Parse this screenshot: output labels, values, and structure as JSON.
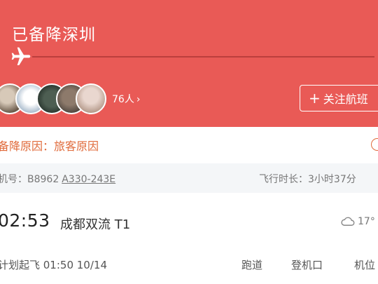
{
  "header": {
    "status": "已备降深圳",
    "follower_count": "76人",
    "follow_button_label": "关注航班",
    "follow_button_plus": "+",
    "chevron": "›"
  },
  "reason": {
    "text": "备降原因：旅客原因"
  },
  "meta": {
    "aircraft_label": "机号：B8962",
    "aircraft_model": "A330-243E",
    "duration": "飞行时长：3小时37分"
  },
  "departure": {
    "time": "02:53",
    "airport": "成都双流 T1",
    "temperature": "17°",
    "scheduled": "计划起飞 01:50 10/14"
  },
  "columns": {
    "runway": "跑道",
    "gate": "登机口",
    "stand": "机位"
  },
  "colors": {
    "header_bg": "#e95a56",
    "reason_text": "#e06a3a",
    "meta_bg": "#f4f6f8"
  },
  "icons": {
    "plane": "airplane-icon",
    "info": "info-icon",
    "weather": "cloud-icon",
    "chevron": "chevron-right-icon",
    "plus": "plus-icon"
  }
}
